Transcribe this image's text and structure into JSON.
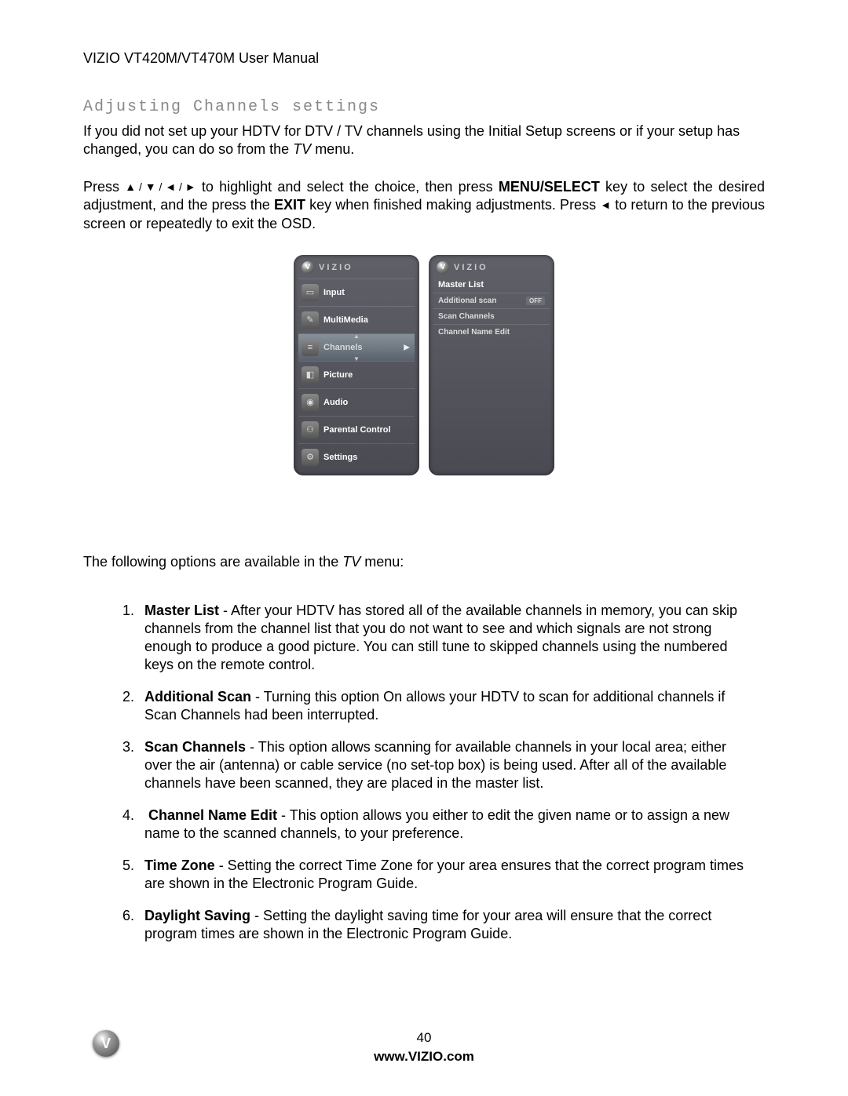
{
  "header": "VIZIO VT420M/VT470M User Manual",
  "section_title": "Adjusting Channels settings",
  "intro": {
    "part1": "If you did not set up your HDTV for DTV / TV channels using the Initial Setup screens or if your setup has changed, you can do so from the ",
    "tv_word": "TV",
    "part2": " menu."
  },
  "press": {
    "p1": "Press ",
    "arrows": "▲ / ▼ / ◄ / ►",
    "p2": " to highlight and select the choice, then press ",
    "key1": "MENU/SELECT",
    "p3": " key to select the desired adjustment, and the press the ",
    "key2": "EXIT",
    "p4": " key when finished making adjustments. Press ",
    "left_arrow": "◄",
    "p5": " to return to the previous screen or repeatedly to exit the OSD."
  },
  "osd": {
    "brand": "VIZIO",
    "items": [
      {
        "label": "Input",
        "icon": "▭"
      },
      {
        "label": "MultiMedia",
        "icon": "✎"
      },
      {
        "label": "Channels",
        "icon": "≡",
        "selected": true
      },
      {
        "label": "Picture",
        "icon": "◧"
      },
      {
        "label": "Audio",
        "icon": "◉"
      },
      {
        "label": "Parental Control",
        "icon": "⚇"
      },
      {
        "label": "Settings",
        "icon": "⚙"
      }
    ],
    "sub": [
      {
        "label": "Master List"
      },
      {
        "label": "Additional scan",
        "badge": "OFF"
      },
      {
        "label": "Scan Channels"
      },
      {
        "label": "Channel Name Edit"
      }
    ]
  },
  "options_intro": {
    "p1": "The following options are available in the ",
    "tv_word": "TV",
    "p2": " menu:"
  },
  "options": [
    {
      "name": "Master List",
      "desc": " -  After your HDTV has stored all of the available channels in memory, you can skip channels from the channel list that you do not want to see and which signals are not strong enough to produce a good picture. You can still tune to skipped channels using the numbered keys on the remote control."
    },
    {
      "name": "Additional Scan",
      "desc": " - Turning this option On allows your HDTV to scan for additional channels if Scan Channels had been interrupted."
    },
    {
      "name": "Scan Channels",
      "desc": " - This option allows scanning for available channels in your local area; either over the air (antenna) or cable service (no set-top box) is being used. After all of the available channels have been scanned, they are placed in the master list."
    },
    {
      "name": "Channel Name Edit",
      "desc": " - This option allows you either to edit the given name or to assign a new name to the scanned channels, to your preference.",
      "leading_space": true
    },
    {
      "name": "Time Zone",
      "desc": " - Setting the correct Time Zone for your area ensures that the correct program times are shown in the Electronic Program Guide."
    },
    {
      "name": "Daylight Saving",
      "desc": " - Setting the daylight saving time for your area will ensure that the correct program times are shown in the Electronic Program Guide."
    }
  ],
  "footer": {
    "page": "40",
    "url": "www.VIZIO.com"
  }
}
